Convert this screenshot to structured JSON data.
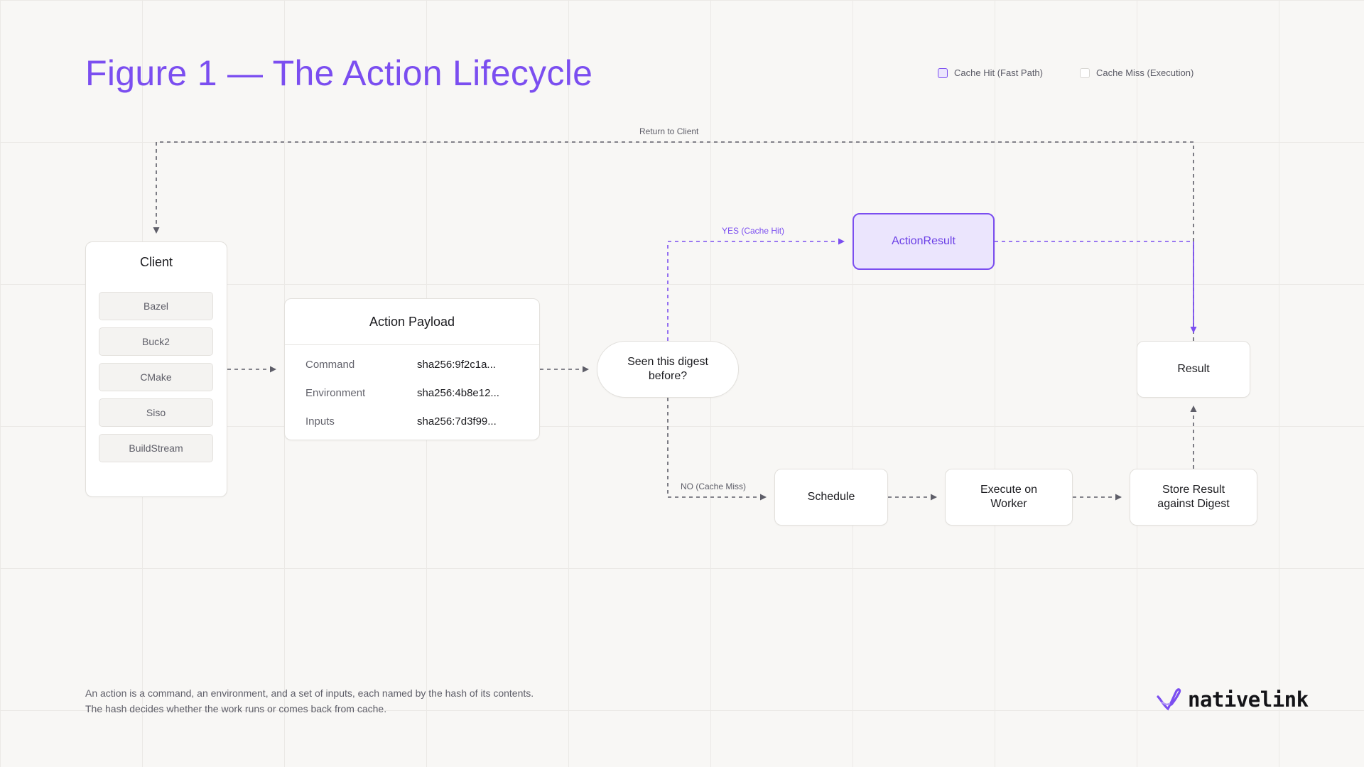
{
  "title": "Figure 1 — The Action Lifecycle",
  "legend": {
    "hit": "Cache Hit (Fast Path)",
    "miss": "Cache Miss (Execution)"
  },
  "client": {
    "title": "Client",
    "items": [
      "Bazel",
      "Buck2",
      "CMake",
      "Siso",
      "BuildStream"
    ]
  },
  "payload": {
    "title": "Action Payload",
    "rows": [
      {
        "key": "Command",
        "value": "sha256:9f2c1a..."
      },
      {
        "key": "Environment",
        "value": "sha256:4b8e12..."
      },
      {
        "key": "Inputs",
        "value": "sha256:7d3f99..."
      }
    ]
  },
  "decision": {
    "line1": "Seen this digest",
    "line2": "before?"
  },
  "action_result": "ActionResult",
  "result": "Result",
  "schedule": "Schedule",
  "execute": {
    "line1": "Execute on",
    "line2": "Worker"
  },
  "store": {
    "line1": "Store Result",
    "line2": "against Digest"
  },
  "edge_labels": {
    "return": "Return to Client",
    "yes": "YES (Cache Hit)",
    "no": "NO (Cache Miss)"
  },
  "caption": {
    "line1": "An action is a command, an environment, and a set of inputs, each named by the hash of its contents.",
    "line2": "The hash decides whether the work runs or comes back from cache."
  },
  "brand": "nativelink",
  "colors": {
    "accent": "#7b4ef0",
    "accent_fill": "#ebe5fd",
    "neutral_edge": "#5e5e68"
  }
}
